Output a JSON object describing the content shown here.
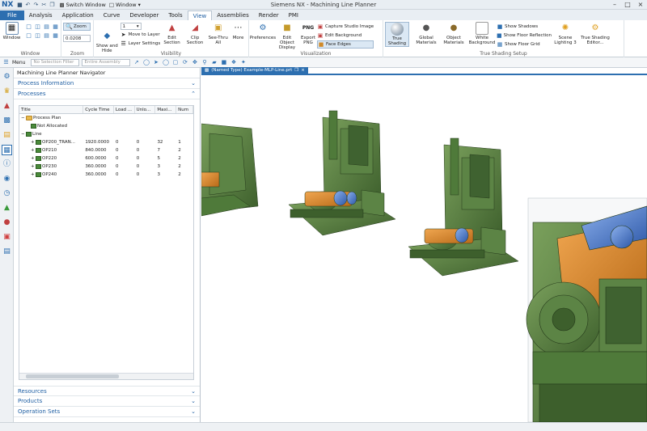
{
  "titlebar": {
    "logo": "NX",
    "switch_window": "Switch Window",
    "window_menu": "Window",
    "app_title": "Siemens NX - Machining Line Planner"
  },
  "tabs": [
    {
      "label": "File"
    },
    {
      "label": "Analysis"
    },
    {
      "label": "Application"
    },
    {
      "label": "Curve"
    },
    {
      "label": "Developer"
    },
    {
      "label": "Tools"
    },
    {
      "label": "View"
    },
    {
      "label": "Assemblies"
    },
    {
      "label": "Render"
    },
    {
      "label": "PMI"
    }
  ],
  "ribbon": {
    "window": {
      "label": "Window",
      "button": "Window"
    },
    "zoom": {
      "label": "Zoom",
      "button": "Zoom",
      "value": "0.0208"
    },
    "visibility": {
      "label": "Visibility",
      "layer_value": "1",
      "show_hide": "Show and Hide",
      "move_layer": "Move to Layer",
      "layer_settings": "Layer Settings",
      "edit_section": "Edit Section",
      "clip_section": "Clip Section",
      "see_thru": "See-Thru All",
      "more": "More"
    },
    "visualization": {
      "label": "Visualization",
      "preferences": "Preferences",
      "edit_object_display": "Edit Object Display",
      "export_png": "Export PNG",
      "png_badge": "PNG",
      "capture": "Capture Studio Image",
      "edit_bg": "Edit Background",
      "face_edges": "Face Edges"
    },
    "shading": {
      "label": "True Shading Setup",
      "true_shading": "True Shading",
      "global_materials": "Global Materials",
      "object_materials": "Object Materials",
      "white_bg": "White Background",
      "show_shadows": "Show Shadows",
      "floor_reflection": "Show Floor Reflection",
      "floor_grid": "Show Floor Grid",
      "scene_lighting": "Scene Lighting 3",
      "editor": "True Shading Editor..."
    }
  },
  "toolbar2": {
    "menu": "Menu",
    "filter": "No Selection Filter",
    "assembly": "Entire Assembly"
  },
  "navigator": {
    "title": "Machining Line Planner Navigator",
    "sections_top": [
      {
        "label": "Process Information"
      },
      {
        "label": "Processes"
      }
    ],
    "columns": [
      "Title",
      "Cycle Time",
      "Load ...",
      "Unlo...",
      "Maxi...",
      "Num"
    ],
    "rows": [
      {
        "title": "Process Plan",
        "indent": 1,
        "icon": "folder",
        "cycle": "",
        "load": "",
        "unload": "",
        "max": "",
        "num": ""
      },
      {
        "title": "Not Allocated",
        "indent": 2,
        "icon": "op",
        "cycle": "",
        "load": "",
        "unload": "",
        "max": "",
        "num": ""
      },
      {
        "title": "Line",
        "indent": 1,
        "icon": "line",
        "cycle": "",
        "load": "",
        "unload": "",
        "max": "",
        "num": ""
      },
      {
        "title": "OP200_TRAN...",
        "indent": 3,
        "icon": "op",
        "cycle": "1920.0000",
        "load": "0",
        "unload": "0",
        "max": "32",
        "num": "1"
      },
      {
        "title": "OP210",
        "indent": 3,
        "icon": "op",
        "cycle": "840.0000",
        "load": "0",
        "unload": "0",
        "max": "7",
        "num": "2"
      },
      {
        "title": "OP220",
        "indent": 3,
        "icon": "op",
        "cycle": "600.0000",
        "load": "0",
        "unload": "0",
        "max": "5",
        "num": "2"
      },
      {
        "title": "OP230",
        "indent": 3,
        "icon": "op",
        "cycle": "360.0000",
        "load": "0",
        "unload": "0",
        "max": "3",
        "num": "2"
      },
      {
        "title": "OP240",
        "indent": 3,
        "icon": "op",
        "cycle": "360.0000",
        "load": "0",
        "unload": "0",
        "max": "3",
        "num": "2"
      }
    ],
    "sections_bottom": [
      {
        "label": "Resources"
      },
      {
        "label": "Products"
      },
      {
        "label": "Operation Sets"
      }
    ]
  },
  "graphics": {
    "tab_label": "(Named Type) Example-MLP-Line.prt"
  },
  "colors": {
    "accent": "#2d6fb0",
    "machine_green": "#4f7a3a",
    "machine_orange": "#e08a2a",
    "machine_blue": "#3a6fc4"
  }
}
